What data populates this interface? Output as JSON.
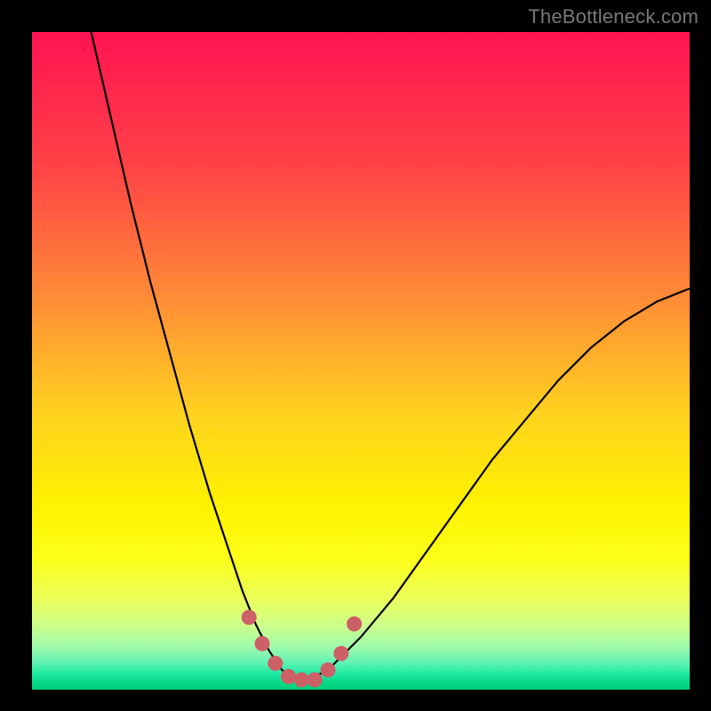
{
  "watermark": "TheBottleneck.com",
  "chart_data": {
    "type": "line",
    "title": "",
    "xlabel": "",
    "ylabel": "",
    "xlim": [
      0,
      100
    ],
    "ylim": [
      0,
      100
    ],
    "grid": false,
    "series": [
      {
        "name": "bottleneck-curve",
        "x": [
          9,
          12,
          15,
          18,
          21,
          24,
          27,
          30,
          32,
          34,
          36,
          38,
          40,
          42,
          45,
          50,
          55,
          60,
          65,
          70,
          75,
          80,
          85,
          90,
          95,
          100
        ],
        "y": [
          100,
          87,
          74,
          62,
          51,
          40,
          30,
          21,
          15,
          10,
          6,
          3,
          1.5,
          1.5,
          3,
          8,
          14,
          21,
          28,
          35,
          41,
          47,
          52,
          56,
          59,
          61
        ]
      }
    ],
    "highlight": {
      "name": "bottom-marker",
      "x": [
        33,
        35,
        37,
        39,
        41,
        43,
        45,
        47,
        49
      ],
      "y": [
        11,
        7,
        4,
        2,
        1.5,
        1.5,
        3,
        5.5,
        10
      ],
      "color": "#cd5f66"
    },
    "gradient_stops": [
      {
        "pos": 0.0,
        "color": "#ff1352"
      },
      {
        "pos": 0.2,
        "color": "#ff4146"
      },
      {
        "pos": 0.4,
        "color": "#ff8a37"
      },
      {
        "pos": 0.58,
        "color": "#ffd21f"
      },
      {
        "pos": 0.72,
        "color": "#fef200"
      },
      {
        "pos": 0.8,
        "color": "#fcff18"
      },
      {
        "pos": 0.86,
        "color": "#ecff58"
      },
      {
        "pos": 0.905,
        "color": "#c9ff8d"
      },
      {
        "pos": 0.935,
        "color": "#9ffbac"
      },
      {
        "pos": 0.958,
        "color": "#63f3b4"
      },
      {
        "pos": 0.975,
        "color": "#22e9a6"
      },
      {
        "pos": 0.99,
        "color": "#04d884"
      },
      {
        "pos": 1.0,
        "color": "#03cf7b"
      }
    ]
  }
}
